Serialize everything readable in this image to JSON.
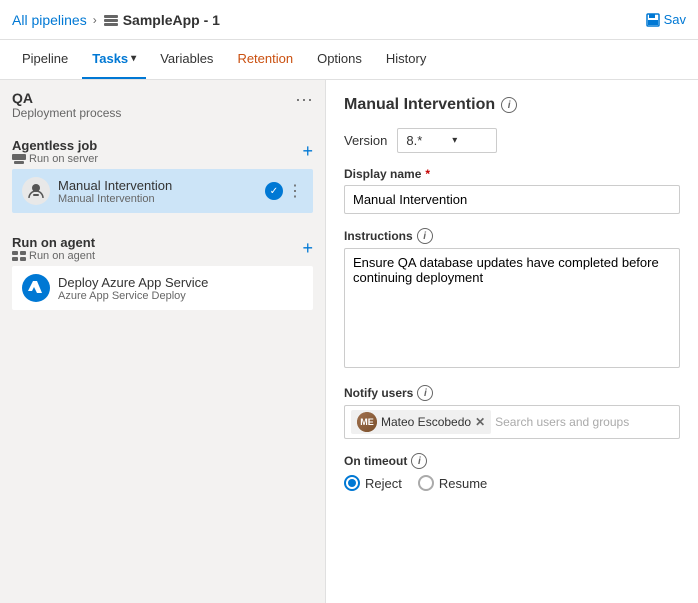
{
  "header": {
    "breadcrumb_link": "All pipelines",
    "breadcrumb_chevron": "›",
    "pipeline_title": "SampleApp - 1",
    "save_label": "Sav"
  },
  "nav": {
    "tabs": [
      {
        "id": "pipeline",
        "label": "Pipeline",
        "active": false,
        "has_dropdown": false,
        "highlight": false
      },
      {
        "id": "tasks",
        "label": "Tasks",
        "active": true,
        "has_dropdown": true,
        "highlight": false
      },
      {
        "id": "variables",
        "label": "Variables",
        "active": false,
        "has_dropdown": false,
        "highlight": false
      },
      {
        "id": "retention",
        "label": "Retention",
        "active": false,
        "has_dropdown": false,
        "highlight": true
      },
      {
        "id": "options",
        "label": "Options",
        "active": false,
        "has_dropdown": false,
        "highlight": false
      },
      {
        "id": "history",
        "label": "History",
        "active": false,
        "has_dropdown": false,
        "highlight": false
      }
    ]
  },
  "left_panel": {
    "stage": {
      "name": "QA",
      "sub": "Deployment process"
    },
    "job_groups": [
      {
        "id": "agentless",
        "title": "Agentless job",
        "sub": "Run on server",
        "has_add": true,
        "tasks": [
          {
            "id": "manual-intervention",
            "name": "Manual Intervention",
            "sub": "Manual Intervention",
            "icon_type": "person",
            "selected": true,
            "has_check": true
          }
        ]
      },
      {
        "id": "run-on-agent",
        "title": "Run on agent",
        "sub": "Run on agent",
        "has_add": true,
        "tasks": [
          {
            "id": "deploy-azure",
            "name": "Deploy Azure App Service",
            "sub": "Azure App Service Deploy",
            "icon_type": "azure",
            "selected": false,
            "has_check": false
          }
        ]
      }
    ]
  },
  "right_panel": {
    "title": "Manual Intervention",
    "version_label": "Version",
    "version_value": "8.*",
    "fields": {
      "display_name_label": "Display name",
      "display_name_required": true,
      "display_name_value": "Manual Intervention",
      "instructions_label": "Instructions",
      "instructions_value": "Ensure QA database updates have completed before continuing deployment",
      "notify_users_label": "Notify users",
      "notify_users": [
        {
          "name": "Mateo Escobedo",
          "initials": "ME"
        }
      ],
      "notify_search_placeholder": "Search users and groups",
      "on_timeout_label": "On timeout",
      "on_timeout_options": [
        {
          "id": "reject",
          "label": "Reject",
          "selected": true
        },
        {
          "id": "resume",
          "label": "Resume",
          "selected": false
        }
      ]
    }
  }
}
